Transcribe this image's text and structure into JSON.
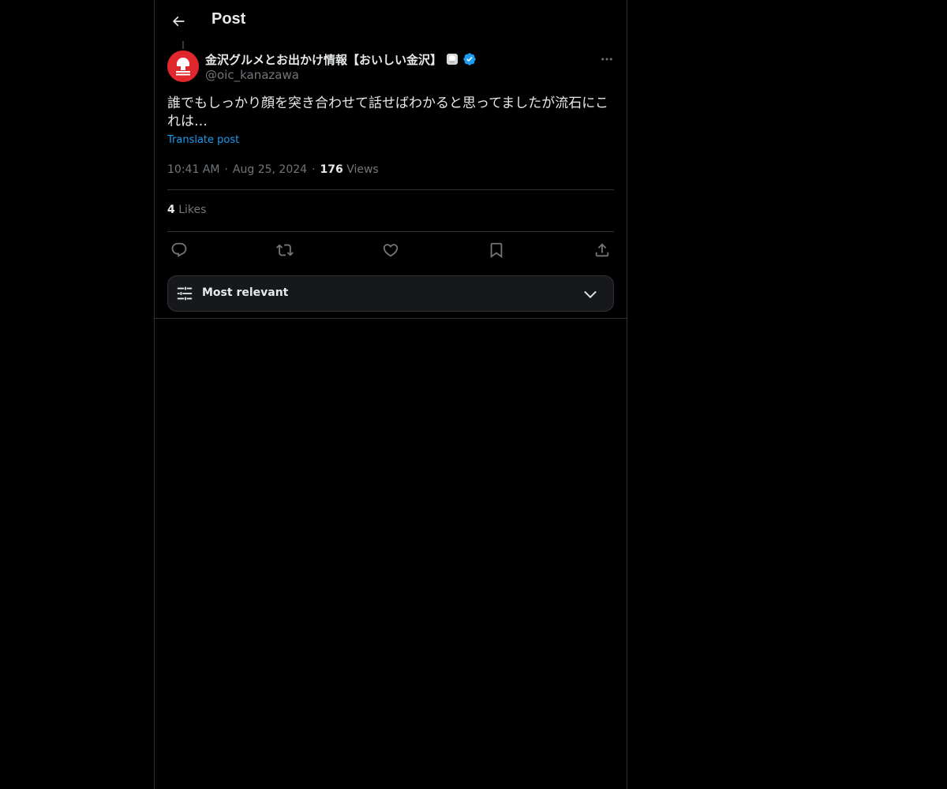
{
  "header": {
    "back_icon": "arrow-left-icon",
    "title": "Post"
  },
  "post": {
    "author": {
      "display_name": "金沢グルメとお出かけ情報【おいしい金沢】",
      "handle": "@oic_kanazawa",
      "avatar_color": "#e0272c",
      "verified": true,
      "verified_color": "#1d9bf0"
    },
    "text": "誰でもしっかり顔を突き合わせて話せばわかると思ってましたが流石にこれは…",
    "translate_label": "Translate post",
    "time": "10:41 AM",
    "separator": "·",
    "date": "Aug 25, 2024",
    "views_count": "176",
    "views_label": "Views",
    "likes_count": "4",
    "likes_label": "Likes"
  },
  "actions": {
    "reply_icon": "reply-icon",
    "repost_icon": "repost-icon",
    "like_icon": "heart-icon",
    "bookmark_icon": "bookmark-icon",
    "share_icon": "share-icon"
  },
  "replies_sort": {
    "label": "Most relevant",
    "icon": "sliders-icon",
    "chevron": "chevron-down-icon"
  },
  "colors": {
    "background": "#000000",
    "text": "#e7e9ea",
    "secondary": "#71767b",
    "accent": "#1d9bf0",
    "border": "#2f3336"
  }
}
